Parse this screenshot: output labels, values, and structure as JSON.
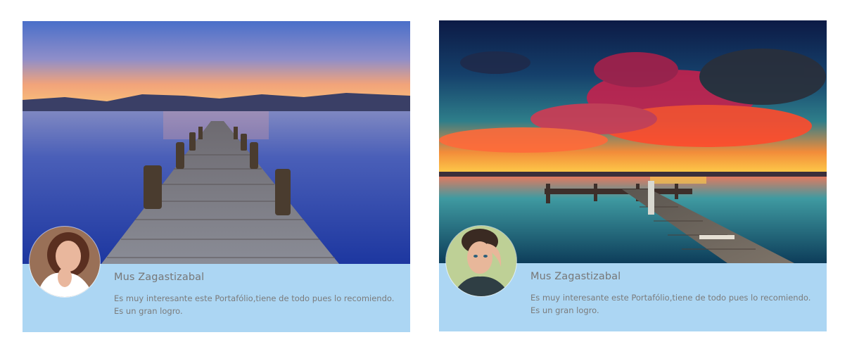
{
  "testimonials": [
    {
      "author": "Mus Zagastizabal",
      "text": "Es muy interesante este Portafólio,tiene de todo pues lo recomiendo. Es un gran logro."
    },
    {
      "author": "Mus Zagastizabal",
      "text": "Es muy interesante este Portafólio,tiene de todo pues lo recomiendo. Es un gran logro."
    }
  ],
  "colors": {
    "card_background": "#acd6f3",
    "text": "#7b7b7b"
  }
}
